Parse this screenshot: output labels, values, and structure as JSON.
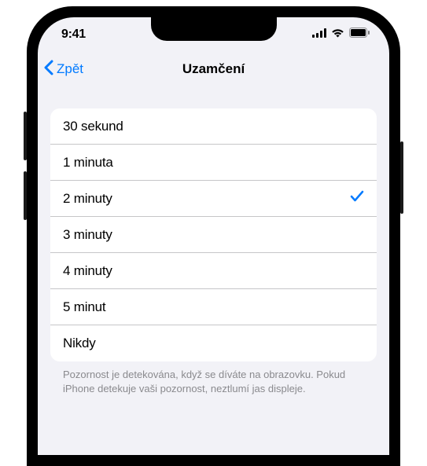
{
  "status": {
    "time": "9:41"
  },
  "nav": {
    "back_label": "Zpět",
    "title": "Uzamčení"
  },
  "options": [
    {
      "label": "30 sekund",
      "selected": false
    },
    {
      "label": "1 minuta",
      "selected": false
    },
    {
      "label": "2 minuty",
      "selected": true
    },
    {
      "label": "3 minuty",
      "selected": false
    },
    {
      "label": "4 minuty",
      "selected": false
    },
    {
      "label": "5 minut",
      "selected": false
    },
    {
      "label": "Nikdy",
      "selected": false
    }
  ],
  "footer": "Pozornost je detekována, když se díváte na obrazovku. Pokud iPhone detekuje vaši pozornost, neztlumí jas displeje."
}
